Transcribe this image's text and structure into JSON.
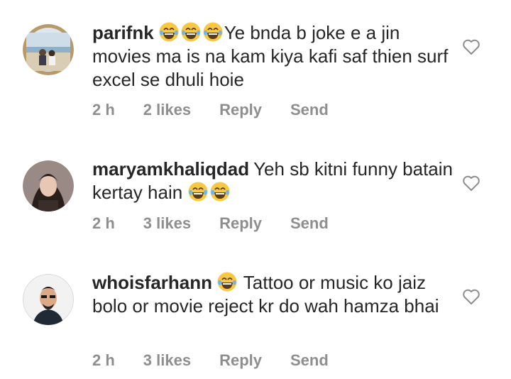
{
  "comments": [
    {
      "username": "parifnk",
      "emojis_before": 3,
      "body": "Ye bnda b joke e a jin movies ma is na kam kiya kafi saf thien surf excel se dhuli hoie",
      "emojis_after": 0,
      "time": "2 h",
      "likes": "2 likes",
      "reply": "Reply",
      "send": "Send",
      "emoji_icon": "laughing-tears-emoji",
      "avatar_icon": "avatar-beach-photo"
    },
    {
      "username": "maryamkhaliqdad",
      "emojis_before": 0,
      "body": "Yeh sb kitni funny batain kertay hain",
      "emojis_after": 2,
      "time": "2 h",
      "likes": "3 likes",
      "reply": "Reply",
      "send": "Send",
      "emoji_icon": "laughing-tears-emoji",
      "avatar_icon": "avatar-woman-photo"
    },
    {
      "username": "whoisfarhann",
      "emojis_before": 1,
      "body": "Tattoo or music ko jaiz bolo or movie reject kr do wah hamza bhai",
      "emojis_after": 0,
      "time": "2 h",
      "likes": "3 likes",
      "reply": "Reply",
      "send": "Send",
      "emoji_icon": "laughing-tears-emoji",
      "avatar_icon": "avatar-man-photo"
    }
  ],
  "colors": {
    "text": "#262626",
    "meta": "#8e8e8e",
    "emoji": "#f7c844"
  },
  "icons": {
    "like": "heart-outline-icon"
  }
}
